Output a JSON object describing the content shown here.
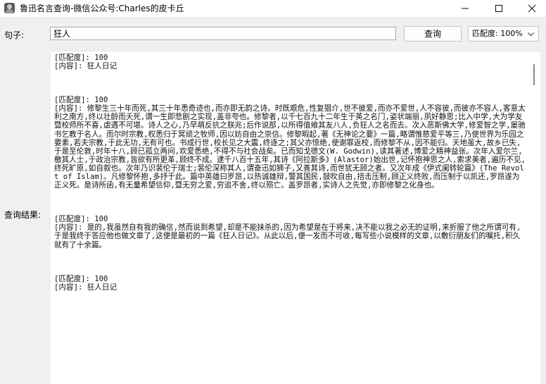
{
  "window": {
    "title": "鲁迅名言查询-微信公众号:Charles的皮卡丘"
  },
  "form": {
    "sentence_label": "句子:",
    "sentence_value": "狂人",
    "query_button": "查询",
    "match_select_value": "匹配度: 100%",
    "result_label": "查询结果:"
  },
  "results": [
    {
      "match": "[匹配度]: 100",
      "content": "[内容]: 狂人日记"
    },
    {
      "match": "[匹配度]: 100",
      "content": "[内容]: 修黎生三十年而死,其三十年悉奇迹也,而亦即无韵之诗。时既艰危,性复猖介,世不彼爱,而亦不爱世,人不容彼,而彼亦不容人,客意太利之南方,终以壮龄而夭死,谓一生即悲剧之实现,盖非夸也。修黎者,以千七百九十二年生于英之名门,姿状端丽,夙好静思;比入中学,大为学友暨校师所不喜,虐遇不可堪。诗人之心,乃早萌反抗之朕兆;后作说部,以所得值飨其友八人,负狂人之名而去。次入恶斯佛大学,修爱智之学,屡驰书乞教于名人。而尔时宗教,权悉归于冥顽之牧师,因以妨自由之崇信。修黎暇起,著《无神论之要》一篇,略谓惟慈爱平等三,乃使世界为乐园之要素,若夫宗教,于此无功,无有可也。书成行世,校长见之大震,终逐之;其父亦惊绝,使谢罪返校,而修黎不从,因不能归。天地虽大,故乡已失,于是至伦敦,时年十八,顾已孤立两间,欢爱悉绝,不得不与社会战矣。已而知戈德文(W. Godwin),读其著述,博爱之精神益张。次年入爱尔兰,檄其人士,于政治宗教,皆欲有所更革,顾终不成。逮千八百十五年,其诗《阿拉斯多》(Alastor)始出世,记怀抱神思之人,索求美者,遍历不见,终死旷原,如自叙也。次年乃识裴伦于瑞士;裴伦深称其人,谓奋迅如狮子,又善其诗,而世犹无顾之者。又次年成《伊式阑转轮篇》(The Revolt of Islam)。凡修黎怀抱,多抒于此。篇中英雄曰罗昂,以热诚雄辩,警其国民,鼓吹自由,掊击压制,顾正义终败,而压制于以凯还,罗昂遂为正义死。是诗所函,有无量希望信仰,暨无穷之爱,穷追不舍,终以殒亡。盖罗昂者,实诗人之先觉,亦即修黎之化身也。"
    },
    {
      "match": "[匹配度]: 100",
      "content": "[内容]: 是的,我虽然自有我的确信,然而说到希望,却是不能抹杀的,因为希望是在于将来,决不能以我之必无的证明,来折服了他之所谓可有,于是我终于答应他也做文章了,这便是最初的一篇《狂人日记》。从此以后,便一发而不可收,每写些小说模样的文章,以敷衍朋友们的嘱托,积久就有了十余篇。"
    },
    {
      "match": "[匹配度]: 100",
      "content": "[内容]: 狂人日记"
    }
  ]
}
